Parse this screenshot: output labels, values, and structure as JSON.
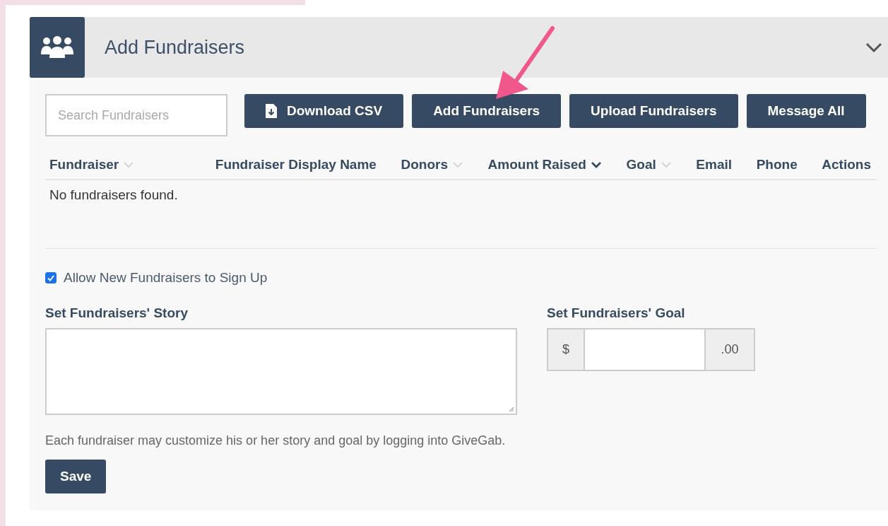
{
  "panel": {
    "title": "Add Fundraisers",
    "expanded": true
  },
  "search": {
    "placeholder": "Search Fundraisers"
  },
  "buttons": [
    {
      "label": "Download CSV",
      "kind": "download"
    },
    {
      "label": "Add Fundraisers",
      "kind": "plain"
    },
    {
      "label": "Upload Fundraisers",
      "kind": "plain"
    },
    {
      "label": "Message All",
      "kind": "plain"
    }
  ],
  "table": {
    "columns": [
      {
        "label": "Fundraiser",
        "sortable": true,
        "sorted": false
      },
      {
        "label": "Fundraiser Display Name",
        "sortable": false,
        "sorted": false
      },
      {
        "label": "Donors",
        "sortable": true,
        "sorted": false
      },
      {
        "label": "Amount Raised",
        "sortable": true,
        "sorted": true
      },
      {
        "label": "Goal",
        "sortable": true,
        "sorted": false
      },
      {
        "label": "Email",
        "sortable": false,
        "sorted": false
      },
      {
        "label": "Phone",
        "sortable": false,
        "sorted": false
      },
      {
        "label": "Actions",
        "sortable": false,
        "sorted": false
      }
    ],
    "empty_message": "No fundraisers found."
  },
  "allow_signup": {
    "label": "Allow New Fundraisers to Sign Up",
    "checked": true
  },
  "story": {
    "label": "Set Fundraisers' Story"
  },
  "goal": {
    "label": "Set Fundraisers' Goal",
    "prefix": "$",
    "suffix": ".00"
  },
  "help_text": "Each fundraiser may customize his or her story and goal by logging into GiveGab.",
  "save_button": "Save"
}
